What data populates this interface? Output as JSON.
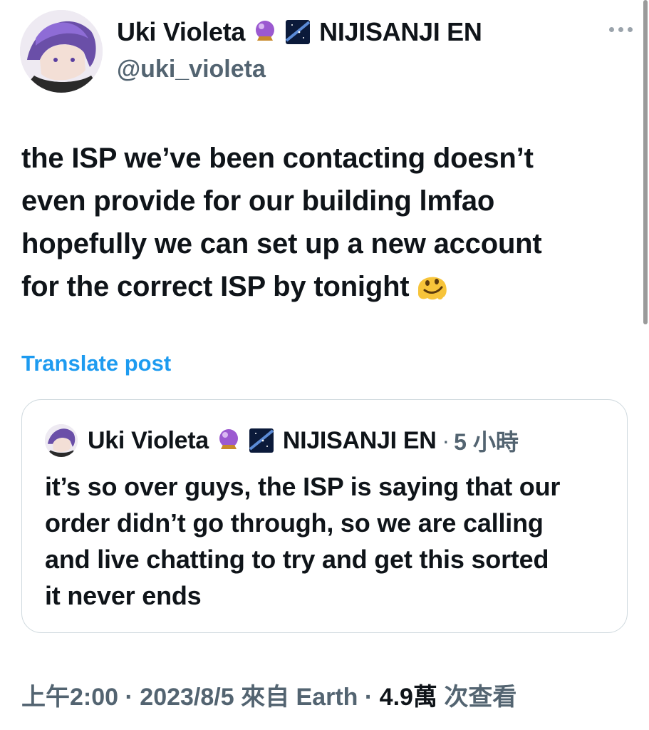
{
  "author": {
    "display_name": "Uki Violeta",
    "affiliation": "NIJISANJI EN",
    "handle": "@uki_violeta",
    "badge_icons": [
      "crystal-ball-emoji",
      "milky-way-emoji"
    ]
  },
  "tweet": {
    "text": "the ISP we’ve been contacting doesn’t\neven provide for our building lmfao\nhopefully we can set up a new account\nfor the correct ISP by tonight",
    "trailing_emoji": "melting-face-emoji"
  },
  "translate_label": "Translate post",
  "quote": {
    "display_name": "Uki Violeta",
    "affiliation": "NIJISANJI EN",
    "separator": "·",
    "time": "5 小時",
    "text": "it’s so over guys, the ISP is saying that our\norder didn’t go through, so we are calling\nand live chatting to try and get this sorted\nit never ends"
  },
  "meta": {
    "time": "上午2:00",
    "sep1": " · ",
    "date": "2023/8/5",
    "source": " 來自 Earth",
    "sep2": " · ",
    "views_count": "4.9萬",
    "views_label": " 次查看"
  },
  "colors": {
    "accent": "#1d9bf0",
    "secondary_text": "#536471",
    "border": "#cfd9de"
  }
}
